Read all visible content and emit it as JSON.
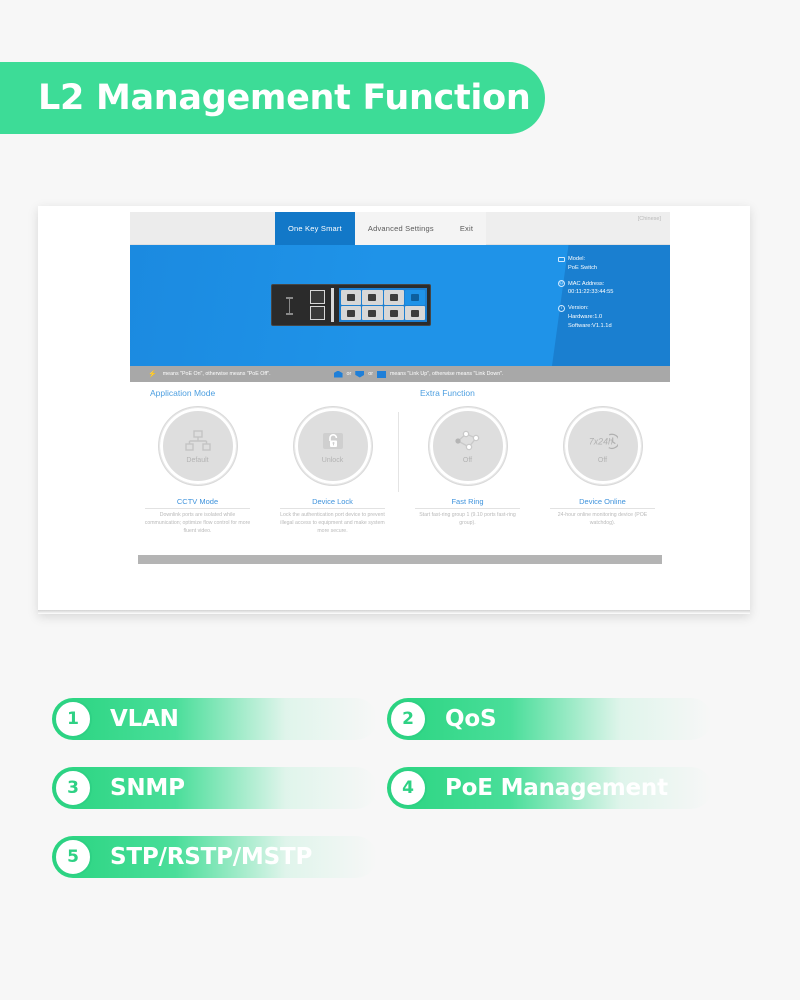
{
  "header": {
    "title": "L2 Management Function"
  },
  "screenshot": {
    "nav": {
      "tabs": [
        {
          "label": "One Key Smart",
          "active": true
        },
        {
          "label": "Advanced Settings",
          "active": false
        },
        {
          "label": "Exit",
          "active": false
        }
      ],
      "language_link": "[Chinese]"
    },
    "info_panel": {
      "model_label": "Model:",
      "model_value": "PoE Switch",
      "mac_label": "MAC Address:",
      "mac_value": "00:11:22:33:44:55",
      "version_label": "Version:",
      "hardware_value": "Hardware:1.0",
      "software_value": "Software:V1.1.1d",
      "model_icon": "switch-icon",
      "mac_icon": "at-sign-icon",
      "version_icon": "info-circle-icon"
    },
    "legend": {
      "poe_text": "means \"PoE On\", otherwise means \"PoE Off\".",
      "poe_icon": "lightning-bolt-icon",
      "link_text": "means \"Link Up\", otherwise means \"Link Down\".",
      "or_text": "or"
    },
    "sections": {
      "application_mode_title": "Application Mode",
      "extra_function_title": "Extra Function"
    },
    "functions": [
      {
        "title": "CCTV Mode",
        "state": "Default",
        "icon": "network-topology-icon",
        "description": "Downlink ports are isolated while communication; optimize flow control for more fluent video."
      },
      {
        "title": "Device Lock",
        "state": "Unlock",
        "icon": "padlock-open-icon",
        "description": "Lock the authentication port device to prevent illegal access to equipment and make system more secure."
      },
      {
        "title": "Fast Ring",
        "state": "Off",
        "icon": "ring-nodes-icon",
        "description": "Start fast-ring group 1 (9.10 ports fast-ring group)."
      },
      {
        "title": "Device Online",
        "state": "Off",
        "icon": "clock-7x24h-icon",
        "description": "24-hour online monitoring device (POE watchdog)."
      }
    ]
  },
  "feature_list": [
    {
      "number": "1",
      "label": "VLAN"
    },
    {
      "number": "2",
      "label": "QoS"
    },
    {
      "number": "3",
      "label": "SNMP"
    },
    {
      "number": "4",
      "label": "PoE Management"
    },
    {
      "number": "5",
      "label": "STP/RSTP/MSTP"
    }
  ],
  "colors": {
    "brand_green": "#2ed184",
    "banner_green": "#3ddc97",
    "ui_blue": "#1f93e8",
    "tab_blue": "#1278c8",
    "link_blue": "#4d9fe0",
    "page_bg": "#f7f7f7"
  }
}
